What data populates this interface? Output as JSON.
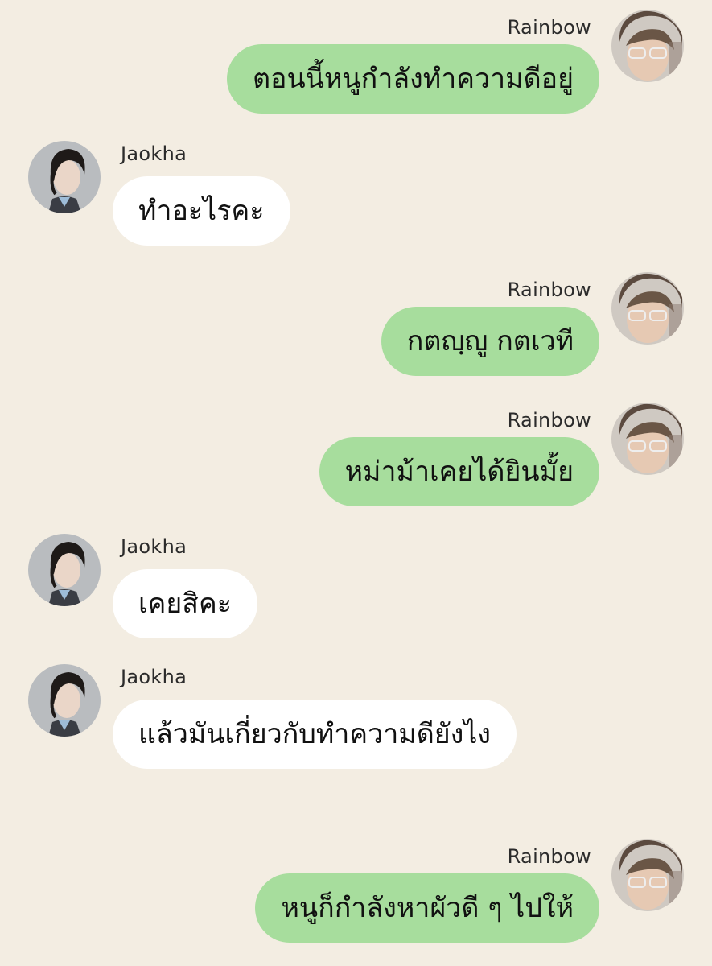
{
  "users": {
    "rainbow": "Rainbow",
    "jaokha": "Jaokha"
  },
  "colors": {
    "background": "#f3ede2",
    "outgoing_bubble": "#a7dd9d",
    "incoming_bubble": "#ffffff"
  },
  "messages": [
    {
      "sender": "Rainbow",
      "side": "right",
      "text": "ตอนนี้หนูกำลังทำความดีอยู่"
    },
    {
      "sender": "Jaokha",
      "side": "left",
      "text": "ทำอะไรคะ"
    },
    {
      "sender": "Rainbow",
      "side": "right",
      "text": "กตญฺญู กตเวที"
    },
    {
      "sender": "Rainbow",
      "side": "right",
      "text": "หม่าม้าเคยได้ยินมั้ย"
    },
    {
      "sender": "Jaokha",
      "side": "left",
      "text": "เคยสิคะ"
    },
    {
      "sender": "Jaokha",
      "side": "left",
      "text": "แล้วมันเกี่ยวกับทำความดียังไง"
    },
    {
      "sender": "Rainbow",
      "side": "right",
      "text": "หนูก็กำลังหาผัวดี ๆ ไปให้"
    }
  ]
}
